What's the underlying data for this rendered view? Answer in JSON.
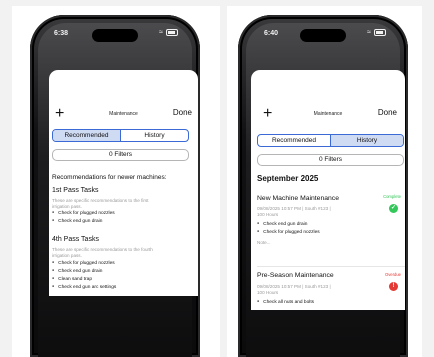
{
  "left_screen": {
    "status_time": "6:38",
    "header": {
      "add_label": "+",
      "title": "Maintenance",
      "done_label": "Done"
    },
    "segments": [
      {
        "label": "Recommended",
        "active": true
      },
      {
        "label": "History",
        "active": false
      }
    ],
    "filters_label": "0 Filters",
    "intro": "Recommendations for newer machines:",
    "sections": [
      {
        "title": "1st Pass Tasks",
        "description": [
          "These are specific recommendations to the first",
          "irrigation pass."
        ],
        "items": [
          "Check for plugged nozzles",
          "Check end gun drain"
        ]
      },
      {
        "title": "4th Pass Tasks",
        "description": [
          "These are specific recommendations to the fourth",
          "irrigation pass."
        ],
        "items": [
          "Check for plugged nozzles",
          "Check end gun drain",
          "Clean sand trap",
          "Check end gun arc settings"
        ]
      }
    ]
  },
  "right_screen": {
    "status_time": "6:40",
    "header": {
      "add_label": "+",
      "title": "Maintenance",
      "done_label": "Done"
    },
    "segments": [
      {
        "label": "Recommended",
        "active": false
      },
      {
        "label": "History",
        "active": true
      }
    ],
    "filters_label": "0 Filters",
    "month": "September 2025",
    "records": [
      {
        "title": "New Machine Maintenance",
        "status": "Complete",
        "status_color": "#34c759",
        "status_icon": "checkmark-icon",
        "meta_line1": "09/08/2025 10:57 PM | South #123 |",
        "meta_line2": "100 Hours",
        "items": [
          "Check end gun drain",
          "Check for plugged nozzles"
        ],
        "note": "Note..."
      },
      {
        "title": "Pre-Season Maintenance",
        "status": "Overdue",
        "status_color": "#e53935",
        "status_icon": "exclamation-icon",
        "meta_line1": "09/08/2025 10:57 PM | South #123 |",
        "meta_line2": "100 Hours",
        "items": [
          "Check all nuts and bolts"
        ]
      }
    ]
  }
}
